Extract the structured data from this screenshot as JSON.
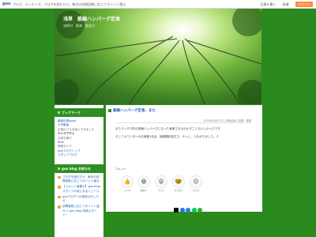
{
  "topbar": {
    "logo": "goo",
    "message": "ブログ、ランキング、ブログを読むだけ。毎月の訪問回数に応じてポイント還元",
    "links": [
      "記事を書く",
      "新着",
      "ログイン"
    ]
  },
  "header": {
    "title": "浅草　鉄線ハンバーグ定食",
    "subtitle": "浅草付　根津　藍染付"
  },
  "sidebar": {
    "bookmark_heading": "ブックマーク",
    "bookmark_items": [
      {
        "text": "最新記事gooo",
        "style": "link"
      },
      {
        "text": "ＧＷ動画",
        "style": "link"
      },
      {
        "text": "広島のバスを巡ってみました",
        "style": "sub"
      },
      {
        "text": "ケイクアウト",
        "style": "bold"
      },
      {
        "text": "お持ち帰り",
        "style": "sub"
      },
      {
        "text": "Bolo",
        "style": "link"
      },
      {
        "text": "検索ガイド",
        "style": "sub"
      },
      {
        "text": "gooブログトップ",
        "style": "link"
      },
      {
        "text": "スタッフブログ",
        "style": "link"
      }
    ],
    "info_heading": "goo blog お知らせ",
    "info_items": [
      "ブログを読むだけ。毎月の訪問回数に応じてポイント還元",
      "【コメント募集中】goo blogスタッフの気になるニュース",
      "gooブログへの参加のおしらせ",
      "訪問者数に応じてポイント還元 + goo blog 特典スタート！"
    ]
  },
  "post": {
    "title": "鉄線ハンバーグ定食、また",
    "meta": "2024年08月21日 | 鉄線定食 | 相撲・格闘",
    "paragraphs": [
      "またランチで町の鉄線ハンバーグになった食事できるのかすごくおいしかったです",
      "そしてカウンターのお客様1名目、機械翻訳英文で、やっと、つながりました。"
    ],
    "emoji": "😄",
    "comment_label": "コメント",
    "reactions": [
      {
        "label": "いいね",
        "icon": "👍"
      },
      {
        "label": "面白い",
        "icon": "😆"
      },
      {
        "label": "すごい",
        "icon": "😮"
      },
      {
        "label": "なるほど",
        "icon": "🤓"
      },
      {
        "label": "ひそか",
        "icon": "😐"
      }
    ],
    "share_icons": [
      "x-icon",
      "facebook-icon",
      "hatena-icon",
      "line-icon",
      "copy-icon"
    ]
  },
  "colors": {
    "background": "#2a8a1e",
    "heading_green": "#2e8f22",
    "link_blue": "#1f5fb8"
  }
}
